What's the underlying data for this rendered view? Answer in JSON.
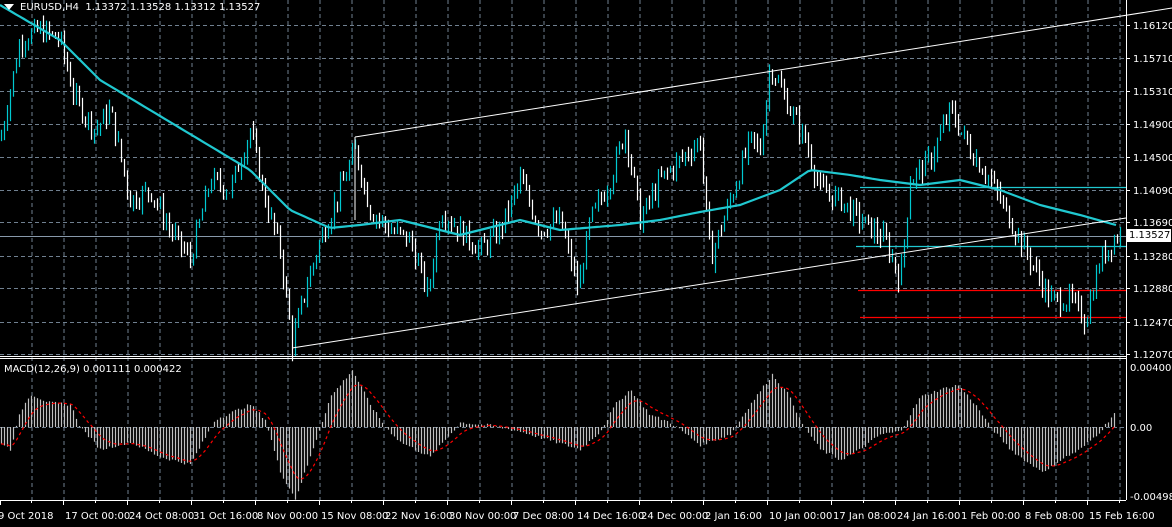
{
  "header": {
    "symbol": "EURUSD,H4",
    "ohlc": "1.13372 1.13528 1.13312 1.13527"
  },
  "macd": {
    "label": "MACD(12,26,9) 0.001111 0.000422",
    "axis": [
      "0.004009",
      "0.00",
      "-0.00498"
    ]
  },
  "current_price": "1.13527",
  "colors": {
    "background": "#000000",
    "grid": "#708090",
    "bull": "#00c8d0",
    "bear": "#ffffff",
    "ma": "#20c8d0",
    "signal": "#ff0000",
    "level": "#ff0000"
  },
  "chart_data": {
    "type": "line",
    "title": "EURUSD,H4",
    "price_axis": [
      "1.16120",
      "1.15710",
      "1.15310",
      "1.14900",
      "1.14500",
      "1.14090",
      "1.13690",
      "1.13280",
      "1.12880",
      "1.12470",
      "1.12070"
    ],
    "ylim": [
      1.1207,
      1.1612
    ],
    "time_labels": [
      "9 Oct 2018",
      "17 Oct 00:00",
      "24 Oct 08:00",
      "31 Oct 16:00",
      "8 Nov 00:00",
      "15 Nov 08:00",
      "22 Nov 16:00",
      "30 Nov 00:00",
      "7 Dec 08:00",
      "14 Dec 16:00",
      "24 Dec 00:00",
      "2 Jan 16:00",
      "10 Jan 00:00",
      "17 Jan 08:00",
      "24 Jan 16:00",
      "1 Feb 00:00",
      "8 Feb 08:00",
      "15 Feb 16:00"
    ],
    "price_path": [
      [
        0,
        1.14704
      ],
      [
        20,
        1.15935
      ],
      [
        40,
        1.16058
      ],
      [
        60,
        1.15935
      ],
      [
        75,
        1.15197
      ],
      [
        95,
        1.14827
      ],
      [
        110,
        1.15074
      ],
      [
        130,
        1.13966
      ],
      [
        150,
        1.14089
      ],
      [
        170,
        1.13596
      ],
      [
        190,
        1.13227
      ],
      [
        210,
        1.14212
      ],
      [
        230,
        1.14089
      ],
      [
        250,
        1.14827
      ],
      [
        265,
        1.13966
      ],
      [
        280,
        1.1335
      ],
      [
        292,
        1.12181
      ],
      [
        305,
        1.12858
      ],
      [
        320,
        1.13473
      ],
      [
        340,
        1.14089
      ],
      [
        355,
        1.14581
      ],
      [
        370,
        1.13843
      ],
      [
        390,
        1.13596
      ],
      [
        410,
        1.13473
      ],
      [
        428,
        1.12796
      ],
      [
        440,
        1.13843
      ],
      [
        460,
        1.13596
      ],
      [
        480,
        1.1335
      ],
      [
        500,
        1.13596
      ],
      [
        520,
        1.14212
      ],
      [
        540,
        1.13596
      ],
      [
        560,
        1.1372
      ],
      [
        578,
        1.12858
      ],
      [
        590,
        1.1372
      ],
      [
        610,
        1.14212
      ],
      [
        625,
        1.14827
      ],
      [
        640,
        1.1372
      ],
      [
        660,
        1.14212
      ],
      [
        680,
        1.14458
      ],
      [
        700,
        1.14704
      ],
      [
        710,
        1.13227
      ],
      [
        730,
        1.13966
      ],
      [
        750,
        1.14704
      ],
      [
        760,
        1.14581
      ],
      [
        770,
        1.15628
      ],
      [
        790,
        1.15074
      ],
      [
        805,
        1.14704
      ],
      [
        820,
        1.14089
      ],
      [
        840,
        1.13966
      ],
      [
        860,
        1.1372
      ],
      [
        885,
        1.13473
      ],
      [
        900,
        1.12981
      ],
      [
        910,
        1.14212
      ],
      [
        930,
        1.14458
      ],
      [
        950,
        1.15074
      ],
      [
        970,
        1.14581
      ],
      [
        990,
        1.14212
      ],
      [
        1010,
        1.1372
      ],
      [
        1030,
        1.13227
      ],
      [
        1050,
        1.12735
      ],
      [
        1070,
        1.12735
      ],
      [
        1085,
        1.12489
      ],
      [
        1100,
        1.13227
      ],
      [
        1116,
        1.13527
      ]
    ],
    "moving_average": [
      [
        0,
        1.16366
      ],
      [
        60,
        1.15935
      ],
      [
        100,
        1.15443
      ],
      [
        150,
        1.15074
      ],
      [
        200,
        1.14704
      ],
      [
        250,
        1.14335
      ],
      [
        290,
        1.13843
      ],
      [
        330,
        1.13621
      ],
      [
        360,
        1.13658
      ],
      [
        400,
        1.1372
      ],
      [
        460,
        1.13535
      ],
      [
        520,
        1.1372
      ],
      [
        560,
        1.13596
      ],
      [
        620,
        1.13658
      ],
      [
        660,
        1.1372
      ],
      [
        700,
        1.13818
      ],
      [
        740,
        1.13904
      ],
      [
        780,
        1.14089
      ],
      [
        810,
        1.14335
      ],
      [
        850,
        1.14274
      ],
      [
        880,
        1.14212
      ],
      [
        920,
        1.1415
      ],
      [
        960,
        1.14212
      ],
      [
        1000,
        1.14089
      ],
      [
        1040,
        1.13904
      ],
      [
        1080,
        1.13781
      ],
      [
        1116,
        1.13658
      ]
    ],
    "trendlines": [
      {
        "name": "channel-lower",
        "from": [
          292,
          1.12144
        ],
        "to": [
          1126,
          1.13744
        ]
      },
      {
        "name": "channel-upper",
        "from": [
          355,
          1.14741
        ],
        "to": [
          1172,
          1.16329
        ]
      }
    ],
    "levels": [
      {
        "price": 1.14126,
        "color": "#20c8d0",
        "start": 860
      },
      {
        "price": 1.134,
        "color": "#20c8d0",
        "start": 856
      },
      {
        "price": 1.12858,
        "color": "#ff0000",
        "start": 858
      },
      {
        "price": 1.12525,
        "color": "#ff0000",
        "start": 860
      }
    ],
    "macd_hist": [
      [
        0,
        -0.001
      ],
      [
        10,
        -0.0015
      ],
      [
        20,
        0.001
      ],
      [
        30,
        0.0022
      ],
      [
        50,
        0.0016
      ],
      [
        70,
        0.0015
      ],
      [
        80,
        0
      ],
      [
        100,
        -0.0015
      ],
      [
        130,
        -0.001
      ],
      [
        160,
        -0.002
      ],
      [
        190,
        -0.0025
      ],
      [
        215,
        0.0005
      ],
      [
        250,
        0.0015
      ],
      [
        265,
        0.0005
      ],
      [
        280,
        -0.003
      ],
      [
        295,
        -0.0048
      ],
      [
        310,
        -0.002
      ],
      [
        330,
        0.002
      ],
      [
        352,
        0.0038
      ],
      [
        370,
        0.0015
      ],
      [
        385,
        0
      ],
      [
        400,
        -0.001
      ],
      [
        430,
        -0.002
      ],
      [
        460,
        0.0003
      ],
      [
        490,
        0.0001
      ],
      [
        520,
        -0.0003
      ],
      [
        545,
        -0.0008
      ],
      [
        580,
        -0.0015
      ],
      [
        600,
        -0.0003
      ],
      [
        615,
        0.0015
      ],
      [
        630,
        0.0025
      ],
      [
        650,
        0.0008
      ],
      [
        670,
        0.0003
      ],
      [
        700,
        -0.0012
      ],
      [
        730,
        -0.0005
      ],
      [
        750,
        0.0015
      ],
      [
        772,
        0.0035
      ],
      [
        790,
        0.002
      ],
      [
        800,
        0.0004
      ],
      [
        820,
        -0.0015
      ],
      [
        840,
        -0.0022
      ],
      [
        860,
        -0.0015
      ],
      [
        880,
        -0.0005
      ],
      [
        900,
        -0.0003
      ],
      [
        920,
        0.002
      ],
      [
        940,
        0.0025
      ],
      [
        958,
        0.0028
      ],
      [
        975,
        0.0015
      ],
      [
        990,
        0
      ],
      [
        1010,
        -0.0015
      ],
      [
        1030,
        -0.0025
      ],
      [
        1045,
        -0.003
      ],
      [
        1060,
        -0.0022
      ],
      [
        1080,
        -0.0015
      ],
      [
        1100,
        -0.0003
      ],
      [
        1116,
        0.0011
      ]
    ],
    "macd_range": [
      -0.00498,
      0.004009
    ]
  }
}
